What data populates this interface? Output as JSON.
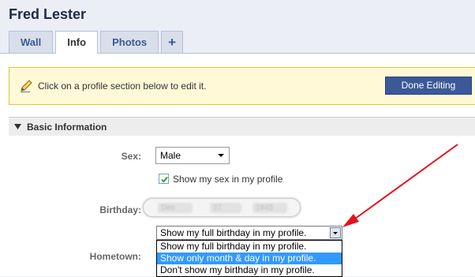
{
  "profile": {
    "name": "Fred Lester"
  },
  "tabs": [
    {
      "label": "Wall"
    },
    {
      "label": "Info"
    },
    {
      "label": "Photos"
    },
    {
      "label": "+"
    }
  ],
  "edit_bar": {
    "message": "Click on a profile section below to edit it.",
    "done_label": "Done Editing"
  },
  "section": {
    "title": "Basic Information"
  },
  "fields": {
    "sex_label": "Sex:",
    "sex_value": "Male",
    "show_sex_label": "Show my sex in my profile",
    "show_sex_checked": true,
    "birthday_label": "Birthday:",
    "birthday_month": "Dec",
    "birthday_day": "27",
    "birthday_year": "1943",
    "hometown_label": "Hometown:"
  },
  "birthday_visibility": {
    "selected": "Show my full birthday in my profile.",
    "options": [
      "Show my full birthday in my profile.",
      "Show only month & day in my profile.",
      "Don't show my birthday in my profile."
    ],
    "highlighted_index": 1
  },
  "colors": {
    "accent": "#3b5998",
    "highlight": "#3399ff",
    "arrow": "#e8111c",
    "notice_bg": "#fff9d7"
  }
}
